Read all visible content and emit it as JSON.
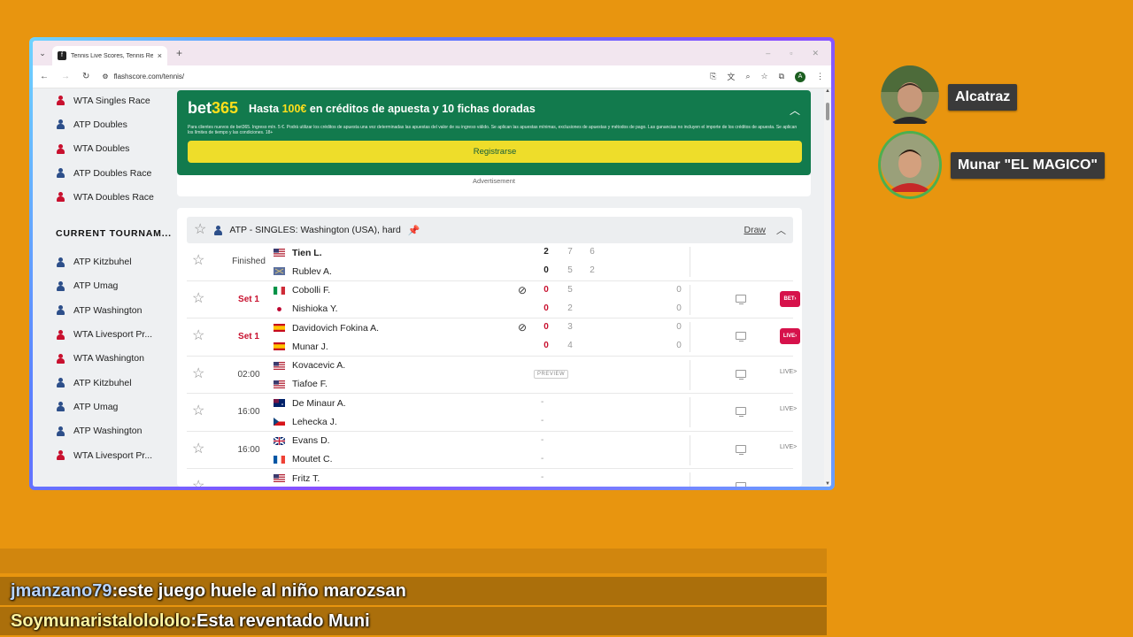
{
  "browser": {
    "tab_title": "Tennis Live Scores, Tennis Results",
    "url": "flashscore.com/tennis/",
    "profile_initial": "A"
  },
  "sidebar": {
    "items_top": [
      {
        "label": "WTA Singles Race",
        "tour": "wta"
      },
      {
        "label": "ATP Doubles",
        "tour": "atp"
      },
      {
        "label": "WTA Doubles",
        "tour": "wta"
      },
      {
        "label": "ATP Doubles Race",
        "tour": "atp"
      },
      {
        "label": "WTA Doubles Race",
        "tour": "wta"
      }
    ],
    "section_title": "CURRENT TOURNAM...",
    "items_current": [
      {
        "label": "ATP Kitzbuhel",
        "tour": "atp"
      },
      {
        "label": "ATP Umag",
        "tour": "atp"
      },
      {
        "label": "ATP Washington",
        "tour": "atp"
      },
      {
        "label": "WTA Livesport Pr...",
        "tour": "wta"
      },
      {
        "label": "WTA Washington",
        "tour": "wta"
      },
      {
        "label": "ATP Kitzbuhel",
        "tour": "atp"
      },
      {
        "label": "ATP Umag",
        "tour": "atp"
      },
      {
        "label": "ATP Washington",
        "tour": "atp"
      },
      {
        "label": "WTA Livesport Pr...",
        "tour": "wta"
      }
    ]
  },
  "ad": {
    "brand_a": "bet",
    "brand_b": "365",
    "headline_a": "Hasta ",
    "headline_amount": "100€",
    "headline_b": " en créditos de apuesta y 10 fichas doradas",
    "small_print": "Para clientes nuevos de bet365. Ingreso mín. 5 €. Podrá utilizar los créditos de apuesta una vez determinadas las apuestas del valor de su ingreso válido. Se aplican las apuestas mínimas, exclusiones de apuestas y métodos de pago. Las ganancias no incluyen el importe de los créditos de apuesta. Se aplican los límites de tiempo y las condiciones. 18+",
    "button": "Registrarse",
    "label": "Advertisement"
  },
  "league": {
    "title": "ATP - SINGLES: Washington (USA), hard",
    "draw": "Draw"
  },
  "matches": [
    {
      "status": "Finished",
      "live": false,
      "p1": {
        "name": "Tien L.",
        "flag": "us",
        "bold": true,
        "s": [
          "2",
          "7",
          "6"
        ],
        "pt": ""
      },
      "p2": {
        "name": "Rublev A.",
        "flag": "neutral",
        "bold": false,
        "s": [
          "0",
          "5",
          "2"
        ],
        "pt": ""
      },
      "serve": 0,
      "tv": false,
      "link": ""
    },
    {
      "status": "Set 1",
      "live": true,
      "p1": {
        "name": "Cobolli F.",
        "flag": "it",
        "bold": false,
        "s": [
          "0",
          "5"
        ],
        "pt": "0"
      },
      "p2": {
        "name": "Nishioka Y.",
        "flag": "jp",
        "bold": false,
        "s": [
          "0",
          "2"
        ],
        "pt": "0"
      },
      "serve": 1,
      "tv": true,
      "link": "BET"
    },
    {
      "status": "Set 1",
      "live": true,
      "p1": {
        "name": "Davidovich Fokina A.",
        "flag": "es",
        "bold": false,
        "s": [
          "0",
          "3"
        ],
        "pt": "0"
      },
      "p2": {
        "name": "Munar J.",
        "flag": "es",
        "bold": false,
        "s": [
          "0",
          "4"
        ],
        "pt": "0"
      },
      "serve": 1,
      "tv": true,
      "link": "LIVE"
    },
    {
      "status": "02:00",
      "live": false,
      "p1": {
        "name": "Kovacevic A.",
        "flag": "us",
        "bold": false,
        "s": [],
        "pt": ""
      },
      "p2": {
        "name": "Tiafoe F.",
        "flag": "us",
        "bold": false,
        "s": [],
        "pt": ""
      },
      "serve": 0,
      "tv": true,
      "link": "LIVE>",
      "preview": "PREVIEW"
    },
    {
      "status": "16:00",
      "live": false,
      "p1": {
        "name": "De Minaur A.",
        "flag": "au",
        "bold": false,
        "s": [
          "-"
        ],
        "pt": ""
      },
      "p2": {
        "name": "Lehecka J.",
        "flag": "cz",
        "bold": false,
        "s": [
          "-"
        ],
        "pt": ""
      },
      "serve": 0,
      "tv": true,
      "link": "LIVE>"
    },
    {
      "status": "16:00",
      "live": false,
      "p1": {
        "name": "Evans D.",
        "flag": "gb",
        "bold": false,
        "s": [
          "-"
        ],
        "pt": ""
      },
      "p2": {
        "name": "Moutet C.",
        "flag": "fr",
        "bold": false,
        "s": [
          "-"
        ],
        "pt": ""
      },
      "serve": 0,
      "tv": true,
      "link": "LIVE>"
    },
    {
      "status": "",
      "live": false,
      "p1": {
        "name": "Fritz T.",
        "flag": "us",
        "bold": false,
        "s": [
          "-"
        ],
        "pt": ""
      },
      "p2": {
        "name": "",
        "flag": "",
        "bold": false,
        "s": [],
        "pt": ""
      },
      "serve": 0,
      "tv": true,
      "link": ""
    }
  ],
  "cams": [
    {
      "label": "Alcatraz"
    },
    {
      "label": "Munar \"EL MAGICO\""
    }
  ],
  "chat": [
    {
      "user": "jmanzano79",
      "sep": " : ",
      "message": "este juego huele al niño marozsan"
    },
    {
      "user": "Soymunaristalolololo",
      "sep": " : ",
      "message": "Esta reventado Muni"
    }
  ],
  "colors": {
    "background": "#e8950f",
    "bet_green": "#127a4d",
    "bet_yellow": "#ffdf1b",
    "live_red": "#c8102e",
    "atp_blue": "#2d4f8a"
  }
}
